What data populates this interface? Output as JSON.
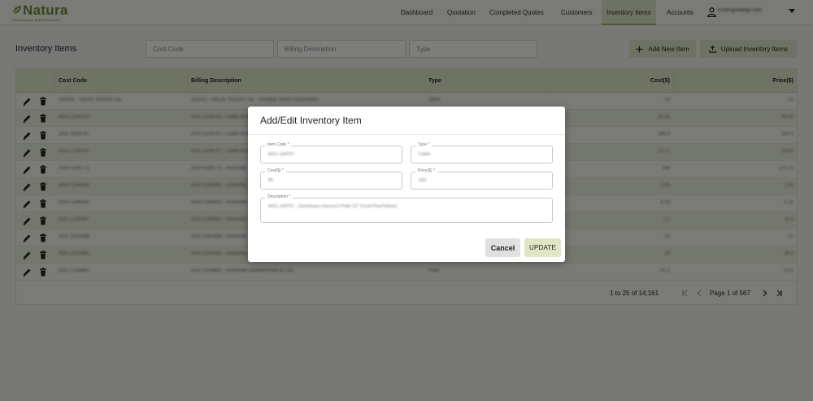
{
  "brand": {
    "name": "Natura",
    "tagline": "Enhancing the Built Environment"
  },
  "nav": {
    "items": [
      "Dashboard",
      "Quotation",
      "Completed Quotes",
      "Customers",
      "Inventory Items",
      "Accounts"
    ],
    "active": "Inventory Items",
    "user_email": "trustmginvbdge.com"
  },
  "toolbar": {
    "page_title": "Inventory Items",
    "filters": {
      "cost_code": "Cost Code",
      "billing_description": "Billing Description",
      "type": "Type"
    },
    "add_label": "Add New Item",
    "upload_label": "Upload Inventory Items"
  },
  "table": {
    "columns": [
      "Cost Code",
      "Billing Description",
      "Type",
      "Cost($)",
      "Price($)"
    ],
    "rows": [
      {
        "code": "100001 - VALVE INDIANTHE",
        "desc": "100001 - VALVE INDIANTHE - Installed Valves Assemblies",
        "type": "Other",
        "cost": "10",
        "price": "10"
      },
      {
        "code": "AGC-1156752",
        "desc": "AGC-1156752 - Cable Assembly",
        "type": "",
        "cost": "31.25",
        "price": "44.43"
      },
      {
        "code": "AGC-1156767",
        "desc": "AGC-1156767 - Cable Assembly",
        "type": "",
        "cost": "180.0",
        "price": "150.0"
      },
      {
        "code": "AGC-1156747",
        "desc": "AGC-1156747 - Cable Assembly",
        "type": "",
        "cost": "117.5",
        "price": "153.0"
      },
      {
        "code": "AGR-1186771",
        "desc": "AGR-1186771 - Assembly",
        "type": "",
        "cost": "198",
        "price": "270.75"
      },
      {
        "code": "AGR-1166082",
        "desc": "AGR-1166082 - Assembly",
        "type": "",
        "cost": "1.95",
        "price": "2.45"
      },
      {
        "code": "AGR-1166082",
        "desc": "AGR-1166082 - Assembly",
        "type": "",
        "cost": "4.10",
        "price": "5.15"
      },
      {
        "code": "AGC-1146487",
        "desc": "AGC-1146487 - Assembly",
        "type": "",
        "cost": "7.1",
        "price": "11.3"
      },
      {
        "code": "AGC-1162488",
        "desc": "AGC-1162488 - Assembly",
        "type": "",
        "cost": "15",
        "price": "27"
      },
      {
        "code": "AGC-1162481",
        "desc": "AGC-1162481 - Assembly",
        "type": "",
        "cost": "28",
        "price": "36.5"
      },
      {
        "code": "AGC-1146882",
        "desc": "AGC-1146882 - Assembly Landstrimmer B' Lite",
        "type": "Plant",
        "cost": "41.2",
        "price": "53.5"
      }
    ],
    "pagination": {
      "range": "1 to 25 of 14,161",
      "page": "Page 1 of 567"
    }
  },
  "modal": {
    "title": "Add/Edit Inventory Item",
    "fields": {
      "item_code": {
        "label": "Item Code *",
        "value": "AGC-144757"
      },
      "type": {
        "label": "Type *",
        "value": "Cable"
      },
      "cost": {
        "label": "Cost($) *",
        "value": "85"
      },
      "price": {
        "label": "Price($) *",
        "value": "100"
      },
      "description": {
        "label": "Description *",
        "value": "AGC-144757 - Gachimacs Harvey's Pride 12\" (Cord Pine/Yellow)"
      }
    },
    "cancel_label": "Cancel",
    "update_label": "UPDATE"
  },
  "colors": {
    "brand_green": "#6e8a3c",
    "accent_bg": "#dde4c8",
    "header_bg": "#dfe6c9",
    "row_alt": "#e9eedc"
  }
}
